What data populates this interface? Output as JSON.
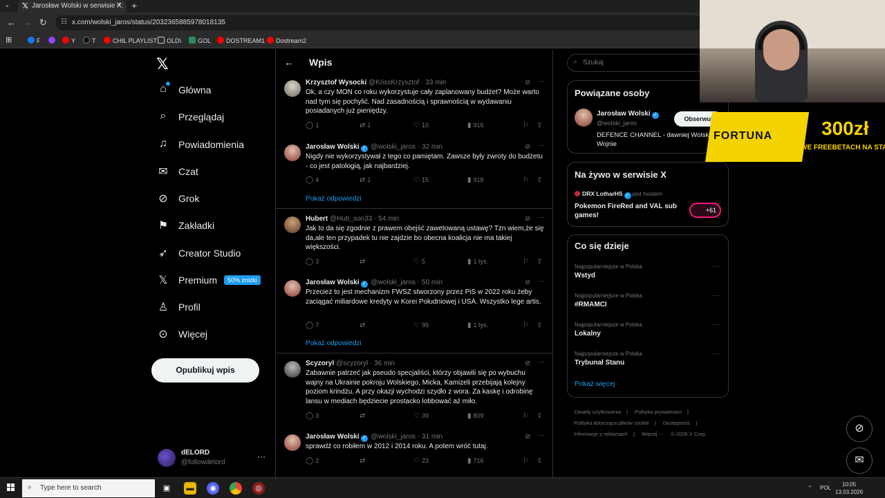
{
  "browser": {
    "tab_title": "Jarosław Wolski w serwisie X: „M",
    "url": "x.com/wolski_jaros/status/2032365885978018135",
    "bookmarks": [
      {
        "label": "F",
        "color": "#1877f2"
      },
      {
        "label": "",
        "color": "#9146ff"
      },
      {
        "label": "Y",
        "color": "#ff0000"
      },
      {
        "label": "T",
        "color": "#111111"
      },
      {
        "label": "CHIL PLAYLIST",
        "color": "#ff0000"
      },
      {
        "label": "OLD\\",
        "color": "#777777"
      },
      {
        "label": "GOL",
        "color": "#2e8b57"
      },
      {
        "label": "DOSTREAM1",
        "color": "#ff0000"
      },
      {
        "label": "Dostream2",
        "color": "#ff0000"
      }
    ]
  },
  "nav": {
    "items": [
      {
        "label": "Główna",
        "icon": "home-icon"
      },
      {
        "label": "Przeglądaj",
        "icon": "search-icon"
      },
      {
        "label": "Powiadomienia",
        "icon": "bell-icon"
      },
      {
        "label": "Czat",
        "icon": "mail-icon"
      },
      {
        "label": "Grok",
        "icon": "grok-icon"
      },
      {
        "label": "Zakładki",
        "icon": "bookmark-icon"
      },
      {
        "label": "Creator Studio",
        "icon": "rocket-icon"
      },
      {
        "label": "Premium",
        "icon": "x-icon"
      },
      {
        "label": "Profil",
        "icon": "person-icon"
      },
      {
        "label": "Więcej",
        "icon": "more-circle-icon"
      }
    ],
    "premium_badge": "50% zniżki",
    "post_button": "Opublikuj wpis",
    "profile": {
      "name": "dELORD",
      "handle": "@followdelord"
    }
  },
  "main": {
    "title": "Wpis",
    "show_replies": "Pokaż odpowiedzi",
    "tweets": [
      {
        "name": "Krzysztof Wysocki",
        "handle": "@KrissKrzysztof",
        "time": "· 33 min",
        "verified": false,
        "text": "Ok, a czy MON co roku wykorzystuje cały zaplanowany budżet? Może warto nad tym się pochylić. Nad zasadnością i sprawnością w wydawaniu posiadanych już pieniędzy.",
        "replies": "1",
        "reposts": "1",
        "likes": "10",
        "views": "916"
      },
      {
        "name": "Jarosław Wolski",
        "handle": "@wolski_jaros",
        "time": "· 32 min",
        "verified": true,
        "text": "Nigdy nie wykorzystywał z tego co pamiętam. Zawsze były zwroty do budżetu - co jest patologią, jak najbardziej.",
        "replies": "4",
        "reposts": "1",
        "likes": "15",
        "views": "918"
      },
      {
        "name": "Hubert",
        "handle": "@Hub_son33",
        "time": "· 54 min",
        "verified": false,
        "text": "Jak to da się zgodnie z prawem obejść zawetowaną ustawę? Tzn wiem,że się da,ale ten przypadek tu nie zajdzie bo obecna koalicja nie ma takiej większości.",
        "replies": "3",
        "reposts": "",
        "likes": "5",
        "views": "1 tys."
      },
      {
        "name": "Jarosław Wolski",
        "handle": "@wolski_jaros",
        "time": "· 50 min",
        "verified": true,
        "text": "Przecież to jest mechanizm FWSZ stworzony przez PiS w 2022 roku żeby zaciągać miliardowe kredyty w Korei Południowej i USA. Wszystko lege artis.",
        "replies": "7",
        "reposts": "",
        "likes": "99",
        "views": "1 tys."
      },
      {
        "name": "Scyzoryl",
        "handle": "@scyzoryl",
        "time": "· 36 min",
        "verified": false,
        "text": "Zabawnie patrzeć jak pseudo specjaliści, którzy objawili się po wybuchu wajny na Ukrainie pokroju Wolskiego, Micka, Kamizeli przebijają kolejny poziom krindżu. A przy okazji wychodzi szydło z wora. Za kaskę i odrobinę lansu w mediach będziecie   prostacko lobbować aż miło.",
        "replies": "3",
        "reposts": "",
        "likes": "39",
        "views": "809"
      },
      {
        "name": "Jarosław Wolski",
        "handle": "@wolski_jaros",
        "time": "· 31 min",
        "verified": true,
        "text": "sprawdź co robiłem w 2012 i 2014 roku. A potem wróć tutaj.",
        "replies": "2",
        "reposts": "",
        "likes": "23",
        "views": "716"
      }
    ]
  },
  "right": {
    "search_placeholder": "Szukaj",
    "related": {
      "title": "Powiązane osoby",
      "name": "Jarosław Wolski",
      "handle": "@wolski_jaros",
      "follow": "Obserwuj",
      "bio": "DEFENCE CHANNEL - dawniej Wolski o Wojnie"
    },
    "live": {
      "title": "Na żywo w serwisie X",
      "host": "DRX LotharHS",
      "host_suffix": "jest hostem",
      "stream_title": "Pokemon FireRed and VAL sub games!",
      "count": "+61"
    },
    "trends": {
      "title": "Co się dzieje",
      "items": [
        {
          "context": "Najpopularniejsze w Polska",
          "name": "Wstyd"
        },
        {
          "context": "Najpopularniejsze w Polska",
          "name": "#RMAMCI"
        },
        {
          "context": "Najpopularniejsze w Polska",
          "name": "Lokalny"
        },
        {
          "context": "Najpopularniejsze w Polska",
          "name": "Trybunał Stanu"
        }
      ],
      "show_more": "Pokaż więcej"
    },
    "footer": [
      "Zasady użytkowania",
      "|",
      "Polityka prywatności",
      "|",
      "Polityka dotycząca plików cookie",
      "|",
      "Dostępność",
      "|",
      "Informacje o reklamach",
      "|",
      "Więcej ···",
      "© 2026 X Corp."
    ]
  },
  "ad": {
    "brand": "FORTUNA",
    "amount": "300zł",
    "tagline": "WE FREEBETACH NA STAR"
  },
  "taskbar": {
    "search_placeholder": "Type here to search",
    "lang": "POL",
    "time": "10:05",
    "date": "13.03.2026"
  }
}
